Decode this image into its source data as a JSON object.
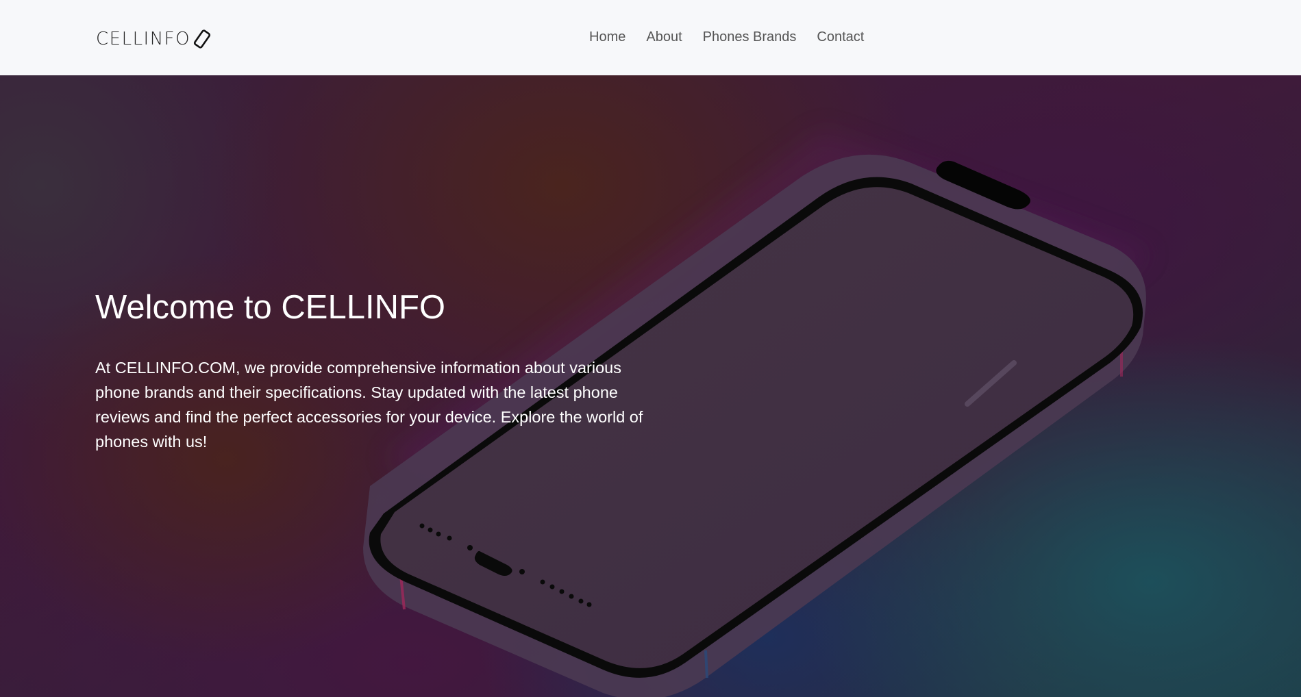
{
  "navbar": {
    "brand": "CELLINFO",
    "brand_icon": "phone-outline-icon",
    "links": [
      "Home",
      "About",
      "Phones Brands",
      "Contact"
    ]
  },
  "hero": {
    "title": "Welcome to CELLINFO",
    "text": "At CELLINFO.COM, we provide comprehensive information about various phone brands and their specifications. Stay updated with the latest phone reviews and find the perfect accessories for your device. Explore the world of phones with us!",
    "background_image": "smartphone-illustration"
  },
  "colors": {
    "navbar_bg": "#f7f8fa",
    "nav_link": "#555555",
    "hero_text": "#ffffff"
  }
}
